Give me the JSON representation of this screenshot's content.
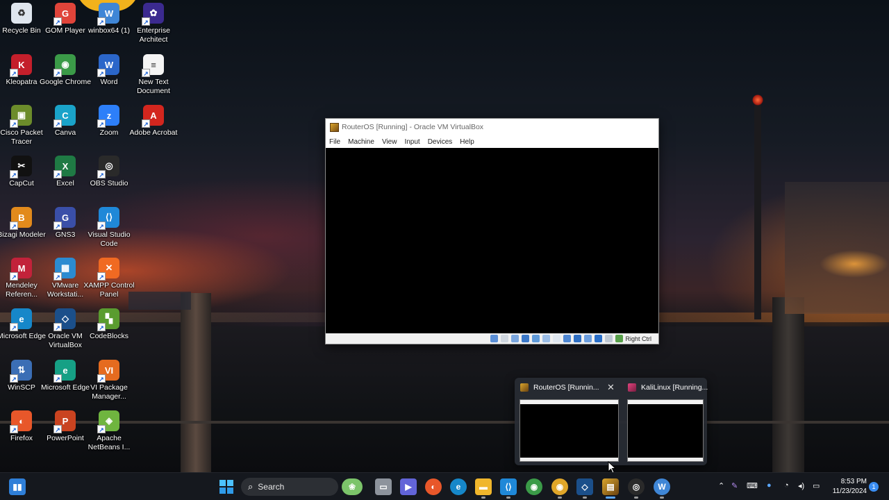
{
  "desktop": {
    "icons": [
      {
        "label": "Recycle Bin",
        "icon": "recycle-bin-icon",
        "color": "#dfe6ee",
        "glyph": "♻"
      },
      {
        "label": "GOM Player",
        "icon": "gom-player-icon",
        "color": "#e0443a",
        "glyph": "G"
      },
      {
        "label": "winbox64 (1)",
        "icon": "winbox-icon",
        "color": "#3f86d6",
        "glyph": "W"
      },
      {
        "label": "Enterprise Architect",
        "icon": "enterprise-architect-icon",
        "color": "#3b2a8f",
        "glyph": "✿"
      },
      {
        "label": "Kleopatra",
        "icon": "kleopatra-icon",
        "color": "#c41f2b",
        "glyph": "K"
      },
      {
        "label": "Google Chrome",
        "icon": "chrome-icon",
        "color": "#3b9b48",
        "glyph": "◉"
      },
      {
        "label": "Word",
        "icon": "word-icon",
        "color": "#2b66c9",
        "glyph": "W"
      },
      {
        "label": "New Text Document",
        "icon": "text-document-icon",
        "color": "#f4f4f4",
        "glyph": "≡"
      },
      {
        "label": "Cisco Packet Tracer",
        "icon": "packet-tracer-icon",
        "color": "#6c8c2b",
        "glyph": "▣"
      },
      {
        "label": "Canva",
        "icon": "canva-icon",
        "color": "#1aa3c9",
        "glyph": "C"
      },
      {
        "label": "Zoom",
        "icon": "zoom-icon",
        "color": "#2d7ff9",
        "glyph": "z"
      },
      {
        "label": "Adobe Acrobat",
        "icon": "acrobat-icon",
        "color": "#d3261e",
        "glyph": "A"
      },
      {
        "label": "CapCut",
        "icon": "capcut-icon",
        "color": "#111111",
        "glyph": "✂"
      },
      {
        "label": "Excel",
        "icon": "excel-icon",
        "color": "#1f7a44",
        "glyph": "X"
      },
      {
        "label": "OBS Studio",
        "icon": "obs-icon",
        "color": "#2a2a2a",
        "glyph": "◎"
      },
      {
        "label": "Bizagi Modeler",
        "icon": "bizagi-icon",
        "color": "#e28a1c",
        "glyph": "B"
      },
      {
        "label": "GNS3",
        "icon": "gns3-icon",
        "color": "#3a4fa8",
        "glyph": "G"
      },
      {
        "label": "Visual Studio Code",
        "icon": "vscode-icon",
        "color": "#1f88d8",
        "glyph": "⟨⟩"
      },
      {
        "label": "Mendeley Referen...",
        "icon": "mendeley-icon",
        "color": "#c2223a",
        "glyph": "M"
      },
      {
        "label": "VMware Workstati...",
        "icon": "vmware-icon",
        "color": "#2b8bd1",
        "glyph": "▦"
      },
      {
        "label": "XAMPP Control Panel",
        "icon": "xampp-icon",
        "color": "#f06a22",
        "glyph": "✕"
      },
      {
        "label": "Microsoft Edge",
        "icon": "edge-icon",
        "color": "#1687c9",
        "glyph": "e"
      },
      {
        "label": "Oracle VM VirtualBox",
        "icon": "virtualbox-icon",
        "color": "#1b4f8a",
        "glyph": "◇"
      },
      {
        "label": "CodeBlocks",
        "icon": "codeblocks-icon",
        "color": "#5a9c2f",
        "glyph": "▚"
      },
      {
        "label": "WinSCP",
        "icon": "winscp-icon",
        "color": "#3b6eb5",
        "glyph": "⇅"
      },
      {
        "label": "Microsoft Edge",
        "icon": "edge-icon",
        "color": "#16a085",
        "glyph": "e"
      },
      {
        "label": "VI Package Manager...",
        "icon": "vi-package-manager-icon",
        "color": "#e56b1f",
        "glyph": "VI"
      },
      {
        "label": "Firefox",
        "icon": "firefox-icon",
        "color": "#e8572a",
        "glyph": "◐"
      },
      {
        "label": "PowerPoint",
        "icon": "powerpoint-icon",
        "color": "#c94320",
        "glyph": "P"
      },
      {
        "label": "Apache NetBeans I...",
        "icon": "netbeans-icon",
        "color": "#6fb53f",
        "glyph": "◈"
      }
    ]
  },
  "vbox_window": {
    "title": "RouterOS [Running] - Oracle VM VirtualBox",
    "menu": [
      "File",
      "Machine",
      "View",
      "Input",
      "Devices",
      "Help"
    ],
    "host_key": "Right Ctrl"
  },
  "thumbnail_popup": {
    "items": [
      {
        "title": "RouterOS [Runnin...",
        "icon": "virtualbox-vm-icon",
        "close_glyph": "✕"
      },
      {
        "title": "KaliLinux [Running...",
        "icon": "virtualbox-vm-icon"
      }
    ]
  },
  "taskbar": {
    "search_placeholder": "Search",
    "clock_time": "8:53 PM",
    "clock_date": "11/23/2024",
    "notification_count": "1"
  }
}
